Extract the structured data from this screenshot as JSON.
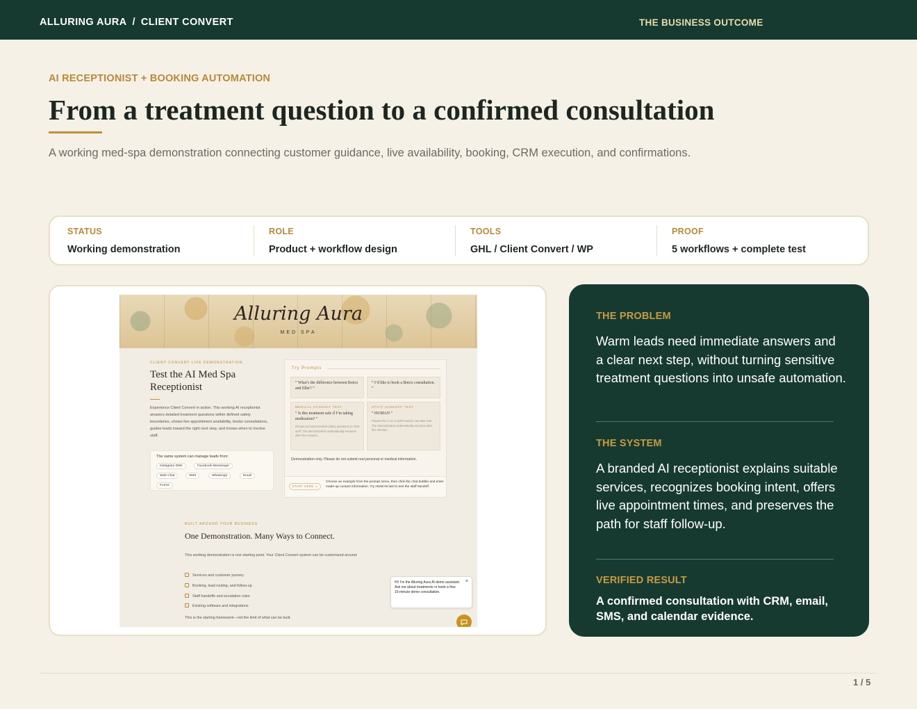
{
  "topbar": {
    "brand": "ALLURING AURA",
    "separator": "/",
    "product": "CLIENT CONVERT",
    "section": "THE BUSINESS OUTCOME"
  },
  "hero": {
    "eyebrow": "AI RECEPTIONIST + BOOKING AUTOMATION",
    "title": "From a treatment question to a confirmed consultation",
    "subtitle": "A working med-spa demonstration connecting customer guidance, live availability, booking, CRM execution, and confirmations."
  },
  "meta": [
    {
      "label": "STATUS",
      "value": "Working demonstration"
    },
    {
      "label": "ROLE",
      "value": "Product + workflow design"
    },
    {
      "label": "TOOLS",
      "value": "GHL / Client Convert / WP"
    },
    {
      "label": "PROOF",
      "value": "5 workflows + complete test"
    }
  ],
  "screenshot": {
    "logo": "Alluring Aura",
    "logo_sub": "MED SPA",
    "kicker": "CLIENT CONVERT LIVE DEMONSTRATION",
    "title": "Test the AI Med Spa Receptionist",
    "intro": "Experience Client Convert in action. This working AI receptionist answers detailed treatment questions within defined safety boundaries, shows live appointment availability, books consultations, guides leads toward the right next step, and knows when to involve staff.",
    "channels_heading": "The same system can manage leads from:",
    "channels": [
      "Instagram DMs",
      "Facebook Messenger",
      "Web Chat",
      "SMS",
      "WhatsApp",
      "Email",
      "Forms"
    ],
    "prompts_heading": "Try Prompts",
    "prompts": [
      {
        "kicker": "",
        "text": "“ What’s the difference between Botox and filler? ”",
        "fine": ""
      },
      {
        "kicker": "",
        "text": "“ I’d like to book a Botox consultation. ”",
        "fine": ""
      },
      {
        "kicker": "MEDICAL HANDOFF TEST",
        "text": "“ Is this treatment safe if I’m taking medication? ”",
        "fine": "Routes personal medical-safety questions to clinic staff. The demonstration automatically resumes after five minutes."
      },
      {
        "kicker": "STAFF HANDOFF TEST",
        "text": "“ HUMAN ”",
        "fine": "Pauses the AI so a staff member can take over. The demonstration automatically resumes after five minutes."
      }
    ],
    "prompts_note": "Demonstration only. Please do not submit real personal or medical information.",
    "start_label": "START HERE ↘",
    "start_text": "Choose an example from the prompt menu, then click the chat bubble and enter made-up contact information. Try HUMAN last to test the staff handoff.",
    "kicker2": "BUILT AROUND YOUR BUSINESS",
    "section_title": "One Demonstration. Many Ways to Connect.",
    "section_body": "This working demonstration is one starting point. Your Client Convert system can be customized around:",
    "list": [
      "Services and customer journey",
      "Booking, lead routing, and follow-up",
      "Staff handoffs and escalation rules",
      "Existing software and integrations"
    ],
    "footer": "This is the starting framework—not the limit of what can be built.",
    "chat_bubble": "Hi! I’m the Alluring Aura AI demo assistant. Ask me about treatments or book a free 15-minute demo consultation.",
    "chat_close": "×"
  },
  "story": {
    "problem_label": "THE PROBLEM",
    "problem_text": "Warm leads need immediate answers and a clear next step, without turning sensitive treatment questions into unsafe automation.",
    "system_label": "THE SYSTEM",
    "system_text": "A branded AI receptionist explains suitable services, recognizes booking intent, offers live appointment times, and preserves the path for staff follow-up.",
    "result_label": "VERIFIED RESULT",
    "result_text": "A confirmed consultation with CRM, email, SMS, and calendar evidence."
  },
  "pager": "1 / 5",
  "colors": {
    "dark_green": "#173a30",
    "gold": "#b8893a",
    "cream": "#f5f1e6"
  }
}
